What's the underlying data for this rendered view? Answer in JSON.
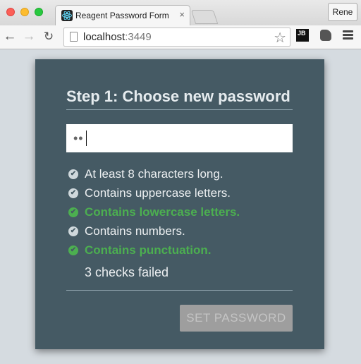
{
  "browser": {
    "tab_title": "Reagent Password Form",
    "tab_close": "×",
    "profile_name": "Rene",
    "url_host": "localhost",
    "url_port": ":3449",
    "icons": {
      "back": "←",
      "forward": "→",
      "reload": "↻",
      "star": "☆",
      "extension_jb": "JB"
    }
  },
  "form": {
    "title": "Step 1: Choose new password",
    "password_value": "••",
    "checks": [
      {
        "label": "At least 8 characters long.",
        "passed": false
      },
      {
        "label": "Contains uppercase letters.",
        "passed": false
      },
      {
        "label": "Contains lowercase letters.",
        "passed": true
      },
      {
        "label": "Contains numbers.",
        "passed": false
      },
      {
        "label": "Contains punctuation.",
        "passed": true
      }
    ],
    "check_mark": "✔",
    "summary": "3 checks failed",
    "submit_label": "SET PASSWORD"
  },
  "colors": {
    "card_bg": "#455a64",
    "page_bg": "#d5dbe0",
    "pass": "#4caf50",
    "fail": "#cfd8dc"
  }
}
